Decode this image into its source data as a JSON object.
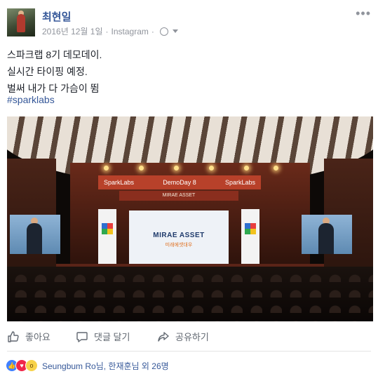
{
  "post": {
    "author": "최현일",
    "date": "2016년 12월 1일",
    "source": "Instagram",
    "separator": "·",
    "more_label": "•••",
    "text_lines": [
      "스파크랩 8기 데모데이.",
      "실시간 타이핑 예정.",
      "벌써 내가 다 가슴이 뜀"
    ],
    "hashtag": "#sparklabs"
  },
  "photo": {
    "banner_left": "SparkLabs",
    "banner_center": "DemoDay 8",
    "banner_right": "SparkLabs",
    "banner_mid": "MIRAE ASSET",
    "screen_brand": "MIRAE ASSET",
    "screen_sub": "미래에셋대우"
  },
  "actions": {
    "like": "좋아요",
    "comment": "댓글 달기",
    "share": "공유하기"
  },
  "reactions": {
    "names": "Seungbum Ro님, 한재훈님 외 26명",
    "icons": [
      "like-icon",
      "love-icon",
      "wow-icon"
    ]
  },
  "colors": {
    "link": "#365899",
    "meta": "#90949c",
    "action_text": "#606770",
    "like_blue": "#4080ff",
    "love_red": "#f0284a",
    "wow_yellow": "#f7d24a"
  }
}
